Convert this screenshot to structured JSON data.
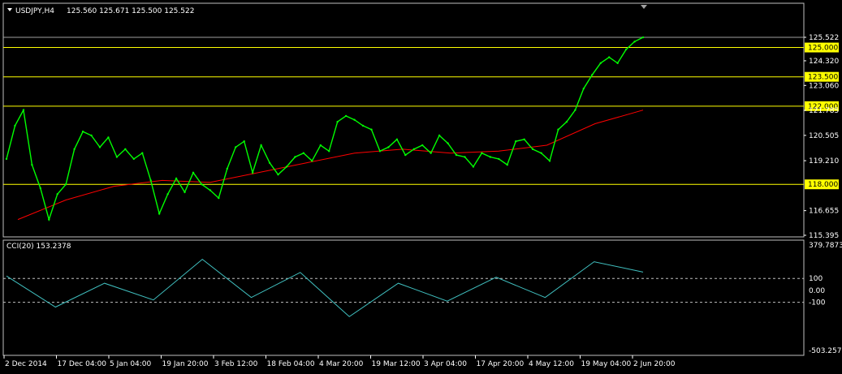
{
  "window": {
    "title": "USDJPY,H4",
    "ohlc_text": "125.560 125.671 125.500 125.522"
  },
  "colors": {
    "background": "#000000",
    "price_line": "#00ff00",
    "ma_line": "#ff0000",
    "hlines": "#ffff00",
    "hline_label_bg": "#ffff00",
    "cci_line": "#40c0c0",
    "axis_text": "#ffffff",
    "border": "#c0c0c0",
    "bid_line": "#a0a0a0"
  },
  "chart_data": [
    {
      "type": "line",
      "title": "USDJPY,H4",
      "subtitle": "125.560 125.671 125.500 125.522",
      "x_ticks": [
        "2 Dec 2014",
        "17 Dec 04:00",
        "5 Jan 04:00",
        "19 Jan 20:00",
        "3 Feb 12:00",
        "18 Feb 04:00",
        "4 Mar 20:00",
        "19 Mar 12:00",
        "3 Apr 04:00",
        "17 Apr 20:00",
        "4 May 12:00",
        "19 May 04:00",
        "2 Jun 20:00"
      ],
      "y_ticks": [
        "125.522",
        "124.320",
        "123.060",
        "121.785",
        "120.505",
        "119.210",
        "116.655",
        "115.395"
      ],
      "ylim": [
        115.395,
        126.6
      ],
      "grid": false,
      "horizontal_lines": [
        {
          "value": 125.0,
          "label": "125.000"
        },
        {
          "value": 123.5,
          "label": "123.500"
        },
        {
          "value": 122.0,
          "label": "122.000"
        },
        {
          "value": 118.0,
          "label": "118.000"
        }
      ],
      "current_price": {
        "value": 125.522,
        "label": "125.522"
      },
      "series": [
        {
          "name": "",
          "x": [
            "2 Dec 2014",
            "4 Dec",
            "8 Dec",
            "9 Dec",
            "11 Dec",
            "12 Dec",
            "15 Dec",
            "16 Dec",
            "17 Dec 04:00",
            "18 Dec",
            "22 Dec",
            "24 Dec",
            "26 Dec",
            "30 Dec",
            "5 Jan 04:00",
            "7 Jan",
            "9 Jan",
            "12 Jan",
            "14 Jan",
            "15 Jan",
            "16 Jan",
            "19 Jan 20:00",
            "21 Jan",
            "23 Jan",
            "27 Jan",
            "29 Jan",
            "3 Feb 12:00",
            "5 Feb",
            "6 Feb",
            "9 Feb",
            "11 Feb",
            "13 Feb",
            "16 Feb",
            "18 Feb 04:00",
            "20 Feb",
            "24 Feb",
            "26 Feb",
            "27 Feb",
            "2 Mar",
            "4 Mar 20:00",
            "6 Mar",
            "10 Mar",
            "12 Mar",
            "16 Mar",
            "18 Mar",
            "19 Mar 12:00",
            "20 Mar",
            "24 Mar",
            "26 Mar",
            "30 Mar",
            "3 Apr 04:00",
            "7 Apr",
            "9 Apr",
            "13 Apr",
            "15 Apr",
            "17 Apr 20:00",
            "21 Apr",
            "23 Apr",
            "27 Apr",
            "29 Apr",
            "4 May 12:00",
            "6 May",
            "8 May",
            "12 May",
            "14 May",
            "19 May 04:00",
            "21 May",
            "22 May",
            "26 May",
            "27 May",
            "28 May",
            "29 May",
            "1 Jun",
            "2 Jun 20:00",
            "3 Jun",
            "4 Jun"
          ],
          "values": [
            119.3,
            121.0,
            121.8,
            119.0,
            117.8,
            116.2,
            117.5,
            118.0,
            119.8,
            120.7,
            120.5,
            119.9,
            120.4,
            119.4,
            119.8,
            119.3,
            119.6,
            118.2,
            116.5,
            117.5,
            118.3,
            117.6,
            118.6,
            118.0,
            117.7,
            117.3,
            118.8,
            119.9,
            120.2,
            118.6,
            120.0,
            119.1,
            118.5,
            118.9,
            119.4,
            119.6,
            119.2,
            120.0,
            119.7,
            121.2,
            121.5,
            121.3,
            121.0,
            120.8,
            119.7,
            119.9,
            120.3,
            119.5,
            119.8,
            120.0,
            119.6,
            120.5,
            120.1,
            119.5,
            119.4,
            118.9,
            119.6,
            119.4,
            119.3,
            119.0,
            120.2,
            120.3,
            119.8,
            119.6,
            119.2,
            120.8,
            121.2,
            121.8,
            122.9,
            123.6,
            124.2,
            124.5,
            124.2,
            124.9,
            125.3,
            125.52
          ]
        },
        {
          "name": "",
          "x": [
            "2 Dec 2014",
            "17 Dec 04:00",
            "5 Jan 04:00",
            "19 Jan 20:00",
            "3 Feb 12:00",
            "18 Feb 04:00",
            "4 Mar 20:00",
            "19 Mar 12:00",
            "3 Apr 04:00",
            "17 Apr 20:00",
            "4 May 12:00",
            "19 May 04:00",
            "2 Jun 20:00",
            "4 Jun"
          ],
          "values": [
            116.2,
            117.2,
            117.9,
            118.2,
            118.1,
            118.6,
            119.1,
            119.6,
            119.8,
            119.6,
            119.7,
            120.0,
            121.1,
            121.8
          ]
        }
      ]
    },
    {
      "type": "line",
      "title": "CCI(20) 153.2378",
      "y_ticks": [
        "379.7873",
        "100",
        "0.00",
        "-100",
        "-503.2579"
      ],
      "ylim": [
        -503.2579,
        379.7873
      ],
      "levels": [
        100,
        -100
      ],
      "series": [
        {
          "name": "",
          "x": [
            "2 Dec 2014",
            "17 Dec 04:00",
            "5 Jan 04:00",
            "19 Jan 20:00",
            "3 Feb 12:00",
            "18 Feb 04:00",
            "4 Mar 20:00",
            "19 Mar 12:00",
            "3 Apr 04:00",
            "17 Apr 20:00",
            "4 May 12:00",
            "19 May 04:00",
            "2 Jun 20:00",
            "4 Jun"
          ],
          "values": [
            120,
            -140,
            60,
            -80,
            260,
            -60,
            150,
            -220,
            60,
            -90,
            110,
            -60,
            240,
            153.2378
          ]
        }
      ]
    }
  ]
}
